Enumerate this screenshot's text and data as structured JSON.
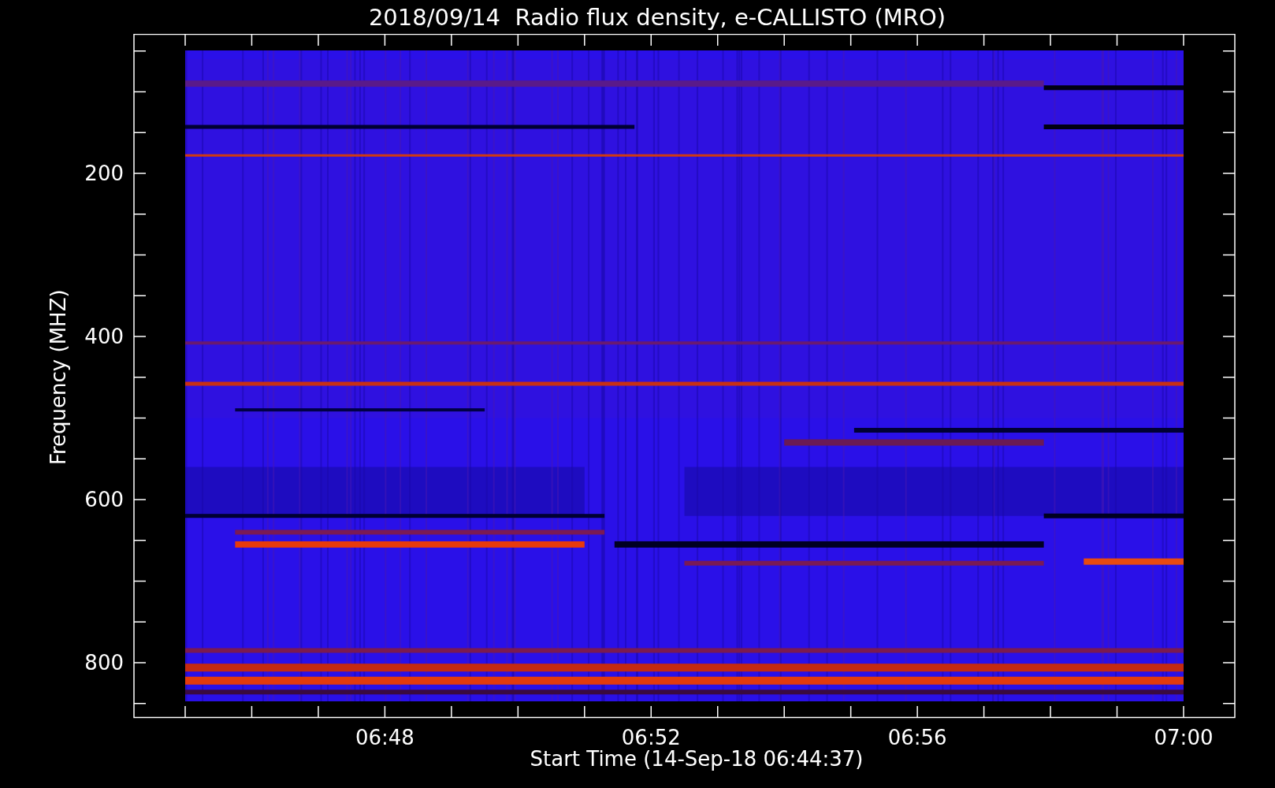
{
  "title": "2018/09/14  Radio flux density, e-CALLISTO (MRO)",
  "y_axis": {
    "label": "Frequency (MHZ)",
    "ticks": [
      "200",
      "400",
      "600",
      "800"
    ]
  },
  "x_axis": {
    "label": "Start Time (14-Sep-18 06:44:37)",
    "ticks": [
      "06:48",
      "06:52",
      "06:56",
      "07:00"
    ]
  }
}
